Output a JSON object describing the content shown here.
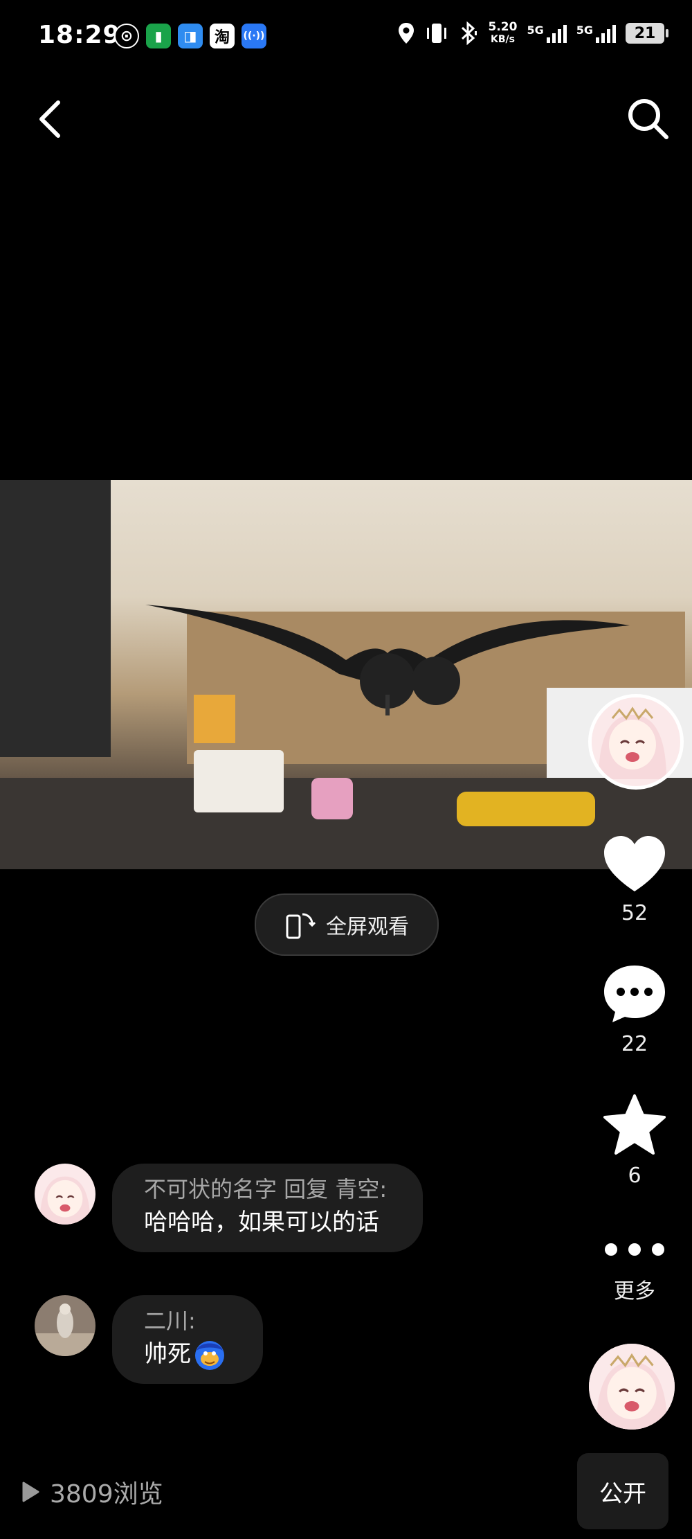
{
  "status_bar": {
    "time": "18:29",
    "app_icons": [
      {
        "name": "netease-icon",
        "glyph": "⊙",
        "bg": "#000000",
        "fg": "#ffffff"
      },
      {
        "name": "green-app-icon",
        "glyph": "▮",
        "bg": "#1aa34a",
        "fg": "#ffffff"
      },
      {
        "name": "blue-app-icon",
        "glyph": "◨",
        "bg": "#2f8cf0",
        "fg": "#ffffff"
      },
      {
        "name": "taobao-icon",
        "glyph": "淘",
        "bg": "#ffffff",
        "fg": "#000000"
      },
      {
        "name": "broadcast-icon",
        "glyph": "((·))",
        "bg": "#2a78f5",
        "fg": "#ffffff"
      }
    ],
    "net_speed_value": "5.20",
    "net_speed_unit": "KB/s",
    "signal1_label": "5G",
    "signal2_label": "5G",
    "battery": "21"
  },
  "video": {
    "fullscreen_label": "全屏观看"
  },
  "rail": {
    "likes": "52",
    "comments": "22",
    "favorites": "6",
    "more_label": "更多"
  },
  "comments": [
    {
      "author": "不可状的名字 回复 青空:",
      "text": "哈哈哈，如果可以的话"
    },
    {
      "author": "二川:",
      "text": "帅死"
    }
  ],
  "footer": {
    "views": "3809浏览",
    "public_label": "公开"
  },
  "colors": {
    "background": "#000000",
    "bubble": "#1e1e1e",
    "muted_text": "#a7a7a7"
  }
}
